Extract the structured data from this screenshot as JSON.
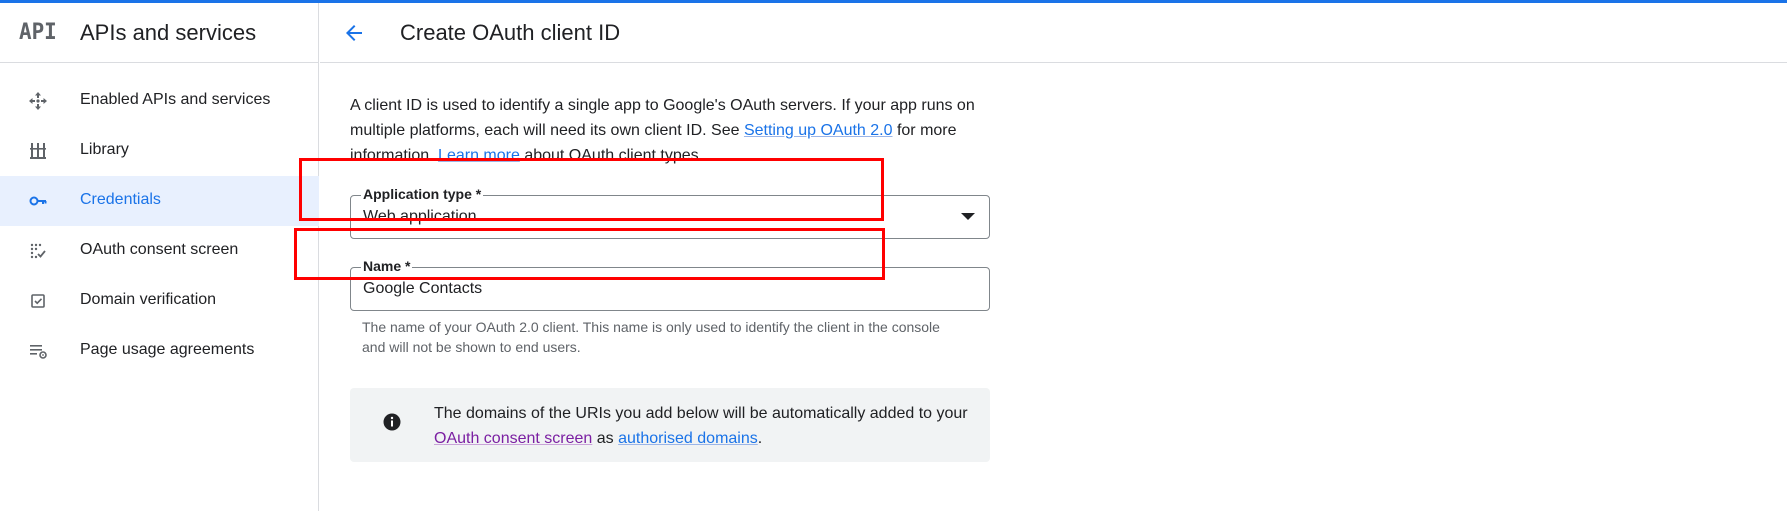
{
  "app": {
    "logo_text": "API",
    "title": "APIs and services"
  },
  "sidebar": {
    "items": [
      {
        "label": "Enabled APIs and services",
        "icon": "enabled-apis-icon",
        "active": false
      },
      {
        "label": "Library",
        "icon": "library-icon",
        "active": false
      },
      {
        "label": "Credentials",
        "icon": "key-icon",
        "active": true
      },
      {
        "label": "OAuth consent screen",
        "icon": "consent-screen-icon",
        "active": false
      },
      {
        "label": "Domain verification",
        "icon": "checkbox-icon",
        "active": false
      },
      {
        "label": "Page usage agreements",
        "icon": "settings-list-icon",
        "active": false
      }
    ]
  },
  "header": {
    "back_icon": "arrow-back-icon",
    "title": "Create OAuth client ID"
  },
  "description": {
    "part1": "A client ID is used to identify a single app to Google's OAuth servers. If your app runs on multiple platforms, each will need its own client ID. See ",
    "link1": "Setting up OAuth 2.0",
    "part2": " for more information. ",
    "link2": "Learn more",
    "part3": " about OAuth client types."
  },
  "form": {
    "application_type": {
      "label": "Application type *",
      "value": "Web application"
    },
    "name": {
      "label": "Name *",
      "value": "Google Contacts",
      "helper": "The name of your OAuth 2.0 client. This name is only used to identify the client in the console and will not be shown to end users."
    }
  },
  "info": {
    "icon": "info-icon",
    "part1": "The domains of the URIs you add below will be automatically added to your ",
    "link1": "OAuth consent screen",
    "part2": " as ",
    "link2": "authorised domains",
    "part3": "."
  },
  "colors": {
    "accent": "#1a73e8",
    "highlight": "#ff0000",
    "active_bg": "#e8f0fe"
  }
}
